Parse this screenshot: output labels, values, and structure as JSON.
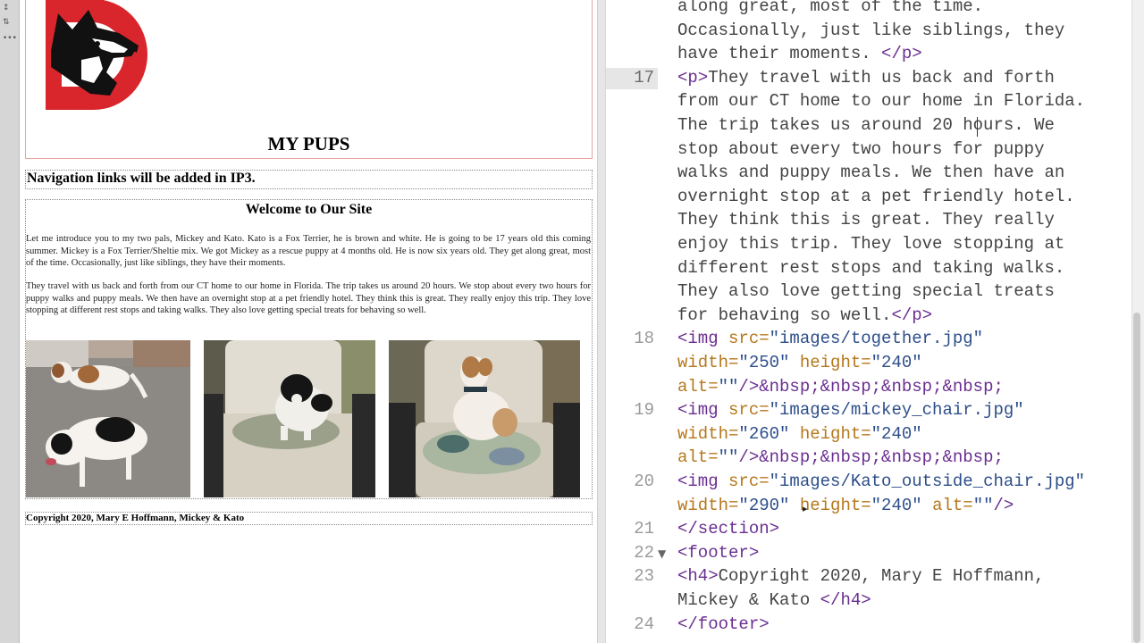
{
  "preview": {
    "site_title": "MY PUPS",
    "nav_text": "Navigation links will be added in IP3.",
    "welcome_heading": "Welcome to Our Site",
    "paragraph1": "Let me introduce you to my two pals, Mickey and Kato. Kato is a Fox Terrier, he is brown and white. He is going to be 17 years old this coming summer. Mickey is a Fox Terrier/Sheltie mix. We got Mickey as a rescue puppy at 4 months old. He is now six years old. They get along great, most of the time. Occasionally, just like siblings, they have their moments.",
    "paragraph2": "They travel with us back and forth from our CT home to our home in Florida. The trip takes us around 20 hours. We stop about every two hours for puppy walks and puppy meals. We then have an overnight stop at a pet friendly hotel. They think this is great. They really enjoy this trip. They love stopping at different rest stops and taking walks. They also love getting special treats for behaving so well.",
    "footer_text": "Copyright 2020, Mary E Hoffmann, Mickey & Kato",
    "logo_letter": "D"
  },
  "editor": {
    "lines": [
      {
        "ln": "",
        "text": "along great, most of the time."
      },
      {
        "ln": "",
        "text": "Occasionally, just like siblings, they"
      },
      {
        "ln": "",
        "text": "have their moments. ",
        "close": "</p>"
      },
      {
        "ln": "17",
        "open": "<p>",
        "text": "They travel with us back and forth"
      },
      {
        "ln": "",
        "text": "from our CT home to our home in Florida."
      },
      {
        "ln": "",
        "text": "The trip takes us around 20 hours. We"
      },
      {
        "ln": "",
        "text": "stop about every two hours for puppy"
      },
      {
        "ln": "",
        "text": "walks and puppy meals. We then have an"
      },
      {
        "ln": "",
        "text": "overnight stop at a pet friendly hotel."
      },
      {
        "ln": "",
        "text": "They think this is great. They really"
      },
      {
        "ln": "",
        "text": "enjoy this trip. They love stopping at"
      },
      {
        "ln": "",
        "text": "different rest stops and taking walks."
      },
      {
        "ln": "",
        "text": "They also love getting special treats"
      },
      {
        "ln": "",
        "text": "for behaving so well.",
        "close": "</p>"
      },
      {
        "ln": "18",
        "tag_open": "<img",
        "attr1": " src=",
        "val1": "\"images/together.jpg\""
      },
      {
        "ln": "",
        "attr1": "width=",
        "val1": "\"250\"",
        "attr2": " height=",
        "val2": "\"240\""
      },
      {
        "ln": "",
        "attr1": "alt=",
        "val1": "\"\"",
        "rest": "/>&nbsp;&nbsp;&nbsp;&nbsp;"
      },
      {
        "ln": "19",
        "tag_open": "<img",
        "attr1": " src=",
        "val1": "\"images/mickey_chair.jpg\""
      },
      {
        "ln": "",
        "attr1": "width=",
        "val1": "\"260\"",
        "attr2": " height=",
        "val2": "\"240\""
      },
      {
        "ln": "",
        "attr1": "alt=",
        "val1": "\"\"",
        "rest": "/>&nbsp;&nbsp;&nbsp;&nbsp;"
      },
      {
        "ln": "20",
        "tag_open": "<img",
        "attr1": " src=",
        "val1": "\"images/Kato_outside_chair.jpg\""
      },
      {
        "ln": "",
        "attr1": "width=",
        "val1": "\"290\"",
        "attr2": " height=",
        "val2": "\"240\"",
        "attr3": " alt=",
        "val3": "\"\"",
        "rest": "/>"
      },
      {
        "ln": "21",
        "tag_line": "</section>"
      },
      {
        "ln": "22",
        "tag_line": "<footer>",
        "fold": "▼"
      },
      {
        "ln": "23",
        "open": "<h4>",
        "text": "Copyright 2020, Mary E Hoffmann,"
      },
      {
        "ln": "",
        "text": "Mickey & Kato ",
        "close": "</h4>"
      },
      {
        "ln": "24",
        "tag_line": "</footer>"
      }
    ]
  },
  "colors": {
    "tag": "#6a2e91",
    "attribute": "#b6771b",
    "string": "#2d4e8a",
    "logo_red": "#d8262c"
  }
}
